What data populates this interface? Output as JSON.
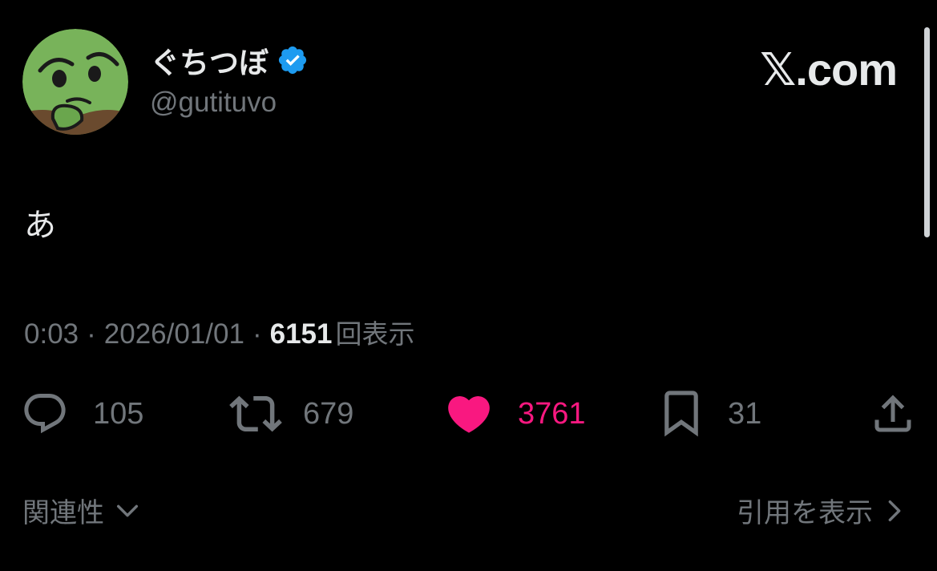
{
  "author": {
    "display_name": "ぐちつぼ",
    "handle": "@gutituvo",
    "verified": true,
    "verified_color": "#1d9bf0",
    "avatar_color": "#78b35a"
  },
  "brand": {
    "x_glyph": "𝕏",
    "domain": ".com"
  },
  "tweet": {
    "text": "あ"
  },
  "meta": {
    "time": "0:03",
    "separator": "·",
    "date": "2026/01/01",
    "views_count": "6151",
    "views_label": "回表示"
  },
  "actions": {
    "reply_count": "105",
    "retweet_count": "679",
    "like_count": "3761",
    "like_color": "#f91880",
    "bookmark_count": "31",
    "icon_names": [
      "reply-icon",
      "retweet-icon",
      "heart-icon",
      "bookmark-icon",
      "share-icon"
    ]
  },
  "footer": {
    "related_label": "関連性",
    "quotes_label": "引用を表示"
  }
}
